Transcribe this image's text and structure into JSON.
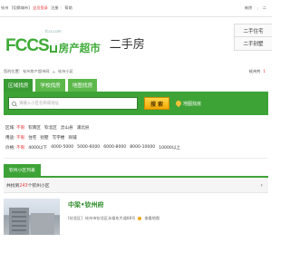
{
  "topbar": {
    "city": "钦州",
    "switch_city": "[切换城市]",
    "member_login": "会员登录",
    "register": "注册",
    "help": "帮助",
    "right_links": [
      "新房",
      "二"
    ]
  },
  "header": {
    "logo_text": "FCCS",
    "logo_cn": "房产超市",
    "logo_url": "fccs.com",
    "channel": "二手房",
    "side_tabs": [
      "二手住宅",
      "二手别墅"
    ]
  },
  "breadcrumb": {
    "label": "您的位置:",
    "items": [
      "钦州房产超市网",
      ">",
      "钦州小区"
    ],
    "right_text_prefix": "钦州共",
    "right_count": "1"
  },
  "tabs": [
    "区域找房",
    "学校找房",
    "地图找房"
  ],
  "search": {
    "placeholder": "请输入小区名称或地址",
    "button": "搜 索",
    "map_link": "地图找房"
  },
  "filters": [
    {
      "label": "区域:",
      "options": [
        "不限",
        "钦南区",
        "钦北区",
        "灵山县",
        "浦北县"
      ]
    },
    {
      "label": "用途:",
      "options": [
        "不限",
        "住宅",
        "别墅",
        "写字楼",
        "商铺"
      ]
    },
    {
      "label": "价格:",
      "options": [
        "不限",
        "4000以下",
        "4000-5000",
        "5000-6000",
        "6000-8000",
        "8000-10000",
        "10000以上"
      ]
    }
  ],
  "result_tab": "钦州小区列表",
  "result_count": {
    "prefix": "共找到",
    "count": "243",
    "suffix": "个钦州小区",
    "arrow": "›"
  },
  "listing": {
    "name": "中梁•钦州府",
    "district": "[钦北区]",
    "address": "钦州市钦北区永福东大道88号",
    "map_link": "查看地图"
  },
  "colors": {
    "brand_green": "#3ea337",
    "highlight_red": "#e4393c",
    "search_button": "#f2a800"
  }
}
